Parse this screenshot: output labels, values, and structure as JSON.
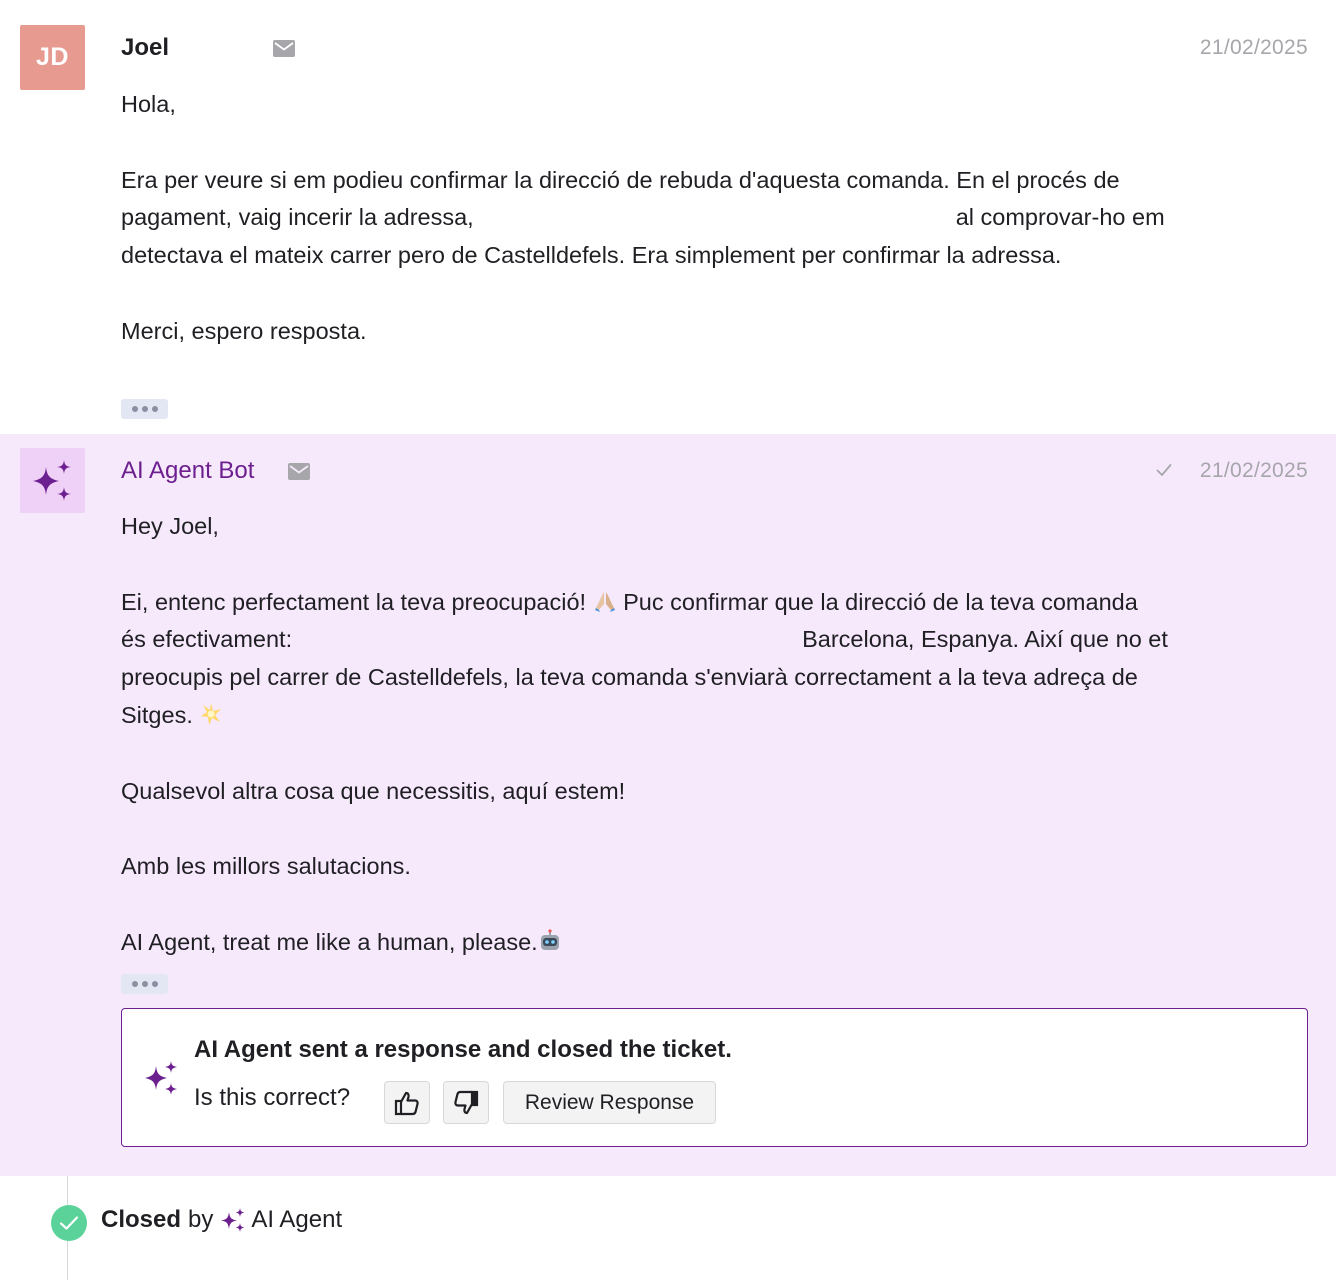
{
  "customer_message": {
    "avatar_initials": "JD",
    "sender": "Joel",
    "date": "21/02/2025",
    "lines": [
      "Hola,",
      "",
      "Era per veure si em podieu confirmar la direcció de rebuda d'aquesta comanda. En el procés de",
      "pagament, vaig incerir la adressa,",
      "detectava el mateix carrer pero de Castelldefels. Era simplement per confirmar la adressa.",
      "",
      "Merci, espero resposta."
    ],
    "line4_after_redaction": "al comprovar-ho em"
  },
  "bot_message": {
    "sender": "AI Agent Bot",
    "date": "21/02/2025",
    "greeting": "Hey Joel,",
    "para1_line1": "Ei, entenc perfectament la teva preocupació!",
    "para1_line1_b": "Puc confirmar que la direcció de la teva comanda",
    "para1_line2_a": "és efectivament:",
    "para1_line2_b": "Barcelona, Espanya. Així que no et",
    "para1_line3": "preocupis pel carrer de Castelldefels, la teva comanda s'enviarà correctament a la teva adreça de",
    "para1_line4": "Sitges.",
    "line_help": "Qualsevol altra cosa que necessitis, aquí estem!",
    "line_regards": "Amb les millors salutacions.",
    "line_signature": "AI Agent, treat me like a human, please."
  },
  "closed_card": {
    "title": "AI Agent sent a response and closed the ticket.",
    "question": "Is this correct?",
    "review_label": "Review Response"
  },
  "status": {
    "closed_label": "Closed",
    "by_label": "by",
    "agent_label": "AI Agent"
  },
  "colors": {
    "bot_background": "#f7e9fc",
    "brand_purple": "#6c1f8f",
    "customer_avatar": "#e79a8f",
    "success_green": "#5bd29a"
  },
  "icons": [
    "mail-icon",
    "sparkle-icon",
    "checkmark-icon",
    "thumbs-up-icon",
    "thumbs-down-icon",
    "pray-emoji",
    "sparkle-emoji",
    "robot-emoji"
  ]
}
